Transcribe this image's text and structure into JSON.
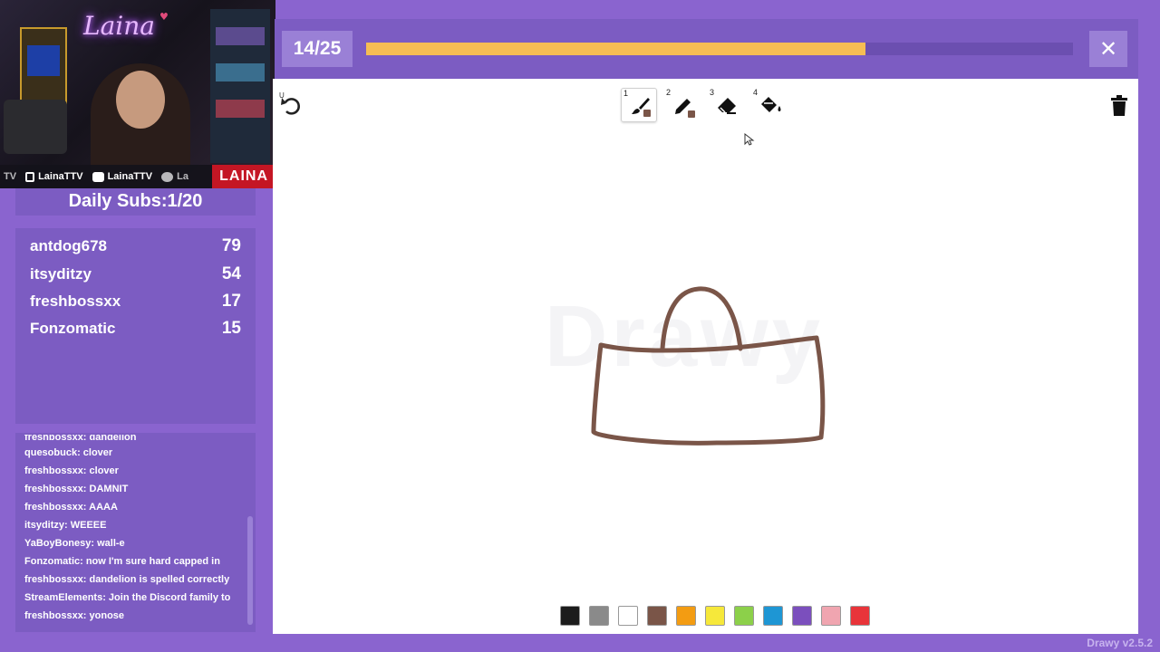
{
  "stream": {
    "streamer_logo": "Laina",
    "social_tiktok": "LainaTTV",
    "social_youtube": "LainaTTV",
    "social_twitter_partial": "La",
    "badge": "LAINA",
    "left_partial": "TV"
  },
  "daily_subs": "Daily Subs:1/20",
  "leaderboard": [
    {
      "name": "antdog678",
      "score": "79"
    },
    {
      "name": "itsyditzy",
      "score": "54"
    },
    {
      "name": "freshbossxx",
      "score": "17"
    },
    {
      "name": "Fonzomatic",
      "score": "15"
    }
  ],
  "chat": [
    "freshbossxx: dandelion",
    "quesobuck: clover",
    "freshbossxx: clover",
    "freshbossxx: DAMNIT",
    "freshbossxx: AAAA",
    "itsyditzy: WEEEE",
    "YaBoyBonesy: wall-e",
    "Fonzomatic: now I'm sure hard capped in",
    "freshbossxx: dandelion is spelled correctly",
    "StreamElements: Join the Discord family to",
    "freshbossxx: yonose"
  ],
  "game": {
    "round_label": "14/25",
    "progress": 0.707,
    "close_icon": "close-icon",
    "tools": [
      {
        "num": "1",
        "icon": "brush-icon",
        "active": true
      },
      {
        "num": "2",
        "icon": "pencil-icon",
        "active": false
      },
      {
        "num": "3",
        "icon": "eraser-icon",
        "active": false
      },
      {
        "num": "4",
        "icon": "fill-bucket-icon",
        "active": false
      }
    ],
    "undo_hotkey": "U",
    "watermark": "Drawy",
    "current_color": "#7a5548",
    "palette": [
      "#1c1c1c",
      "#8a8a8a",
      "#ffffff",
      "#7a5548",
      "#f39c12",
      "#f6e83a",
      "#8cd04a",
      "#1e96d4",
      "#7b4fbd",
      "#f0a5b0",
      "#e8343a"
    ],
    "version": "Drawy v2.5.2"
  },
  "colors": {
    "background": "#8a64cf",
    "panel": "#7c5cc2",
    "progress_fill": "#f6bd54",
    "badge_red": "#c41624"
  }
}
